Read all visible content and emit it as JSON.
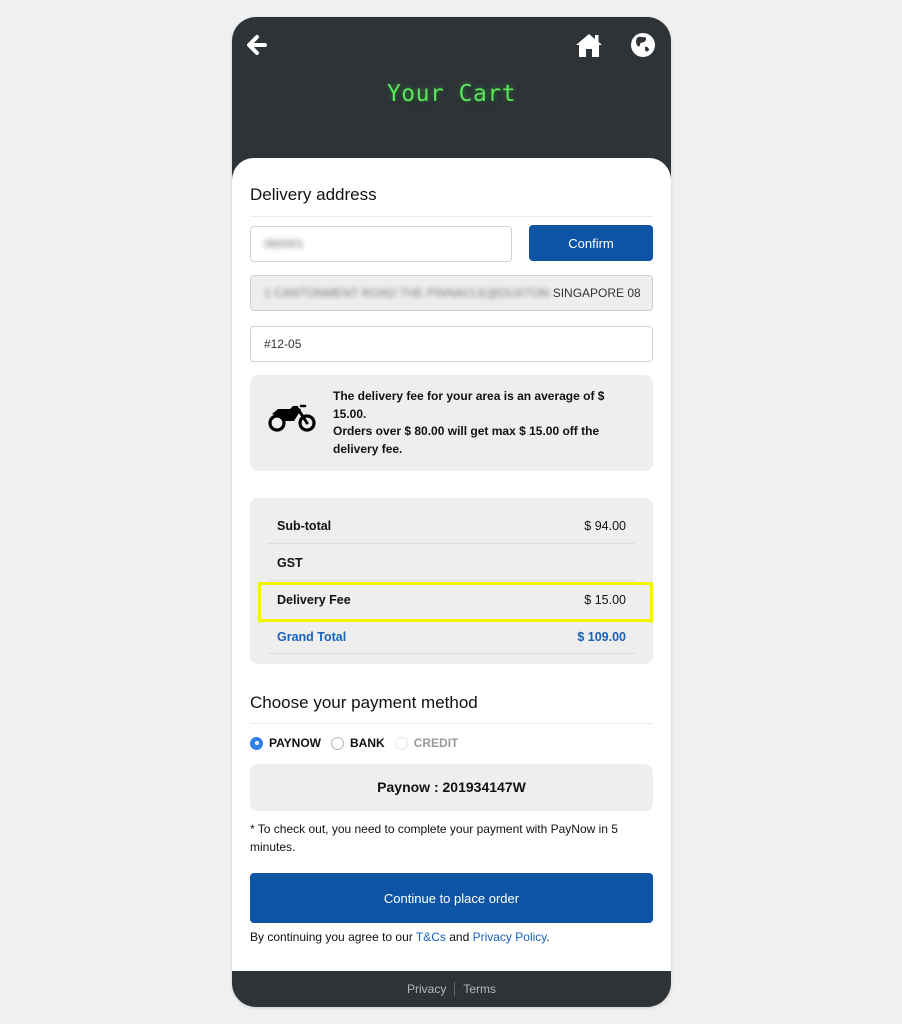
{
  "header": {
    "title": "Your Cart",
    "icons": {
      "back": "arrow-left-icon",
      "home": "home-icon",
      "language": "globe-icon"
    }
  },
  "delivery": {
    "section_title": "Delivery address",
    "postal_code_value": "080001",
    "confirm_label": "Confirm",
    "address_blurred": "1 CANTONMENT ROAD THE PINNACLE@DUXTON",
    "address_visible": "SINGAPORE 08",
    "unit_value": "#12-05",
    "info_icon": "motorcycle-icon",
    "info_line1": "The delivery fee for your area is an average of $ 15.00.",
    "info_line2": "Orders over $ 80.00 will get max $ 15.00 off the delivery fee."
  },
  "totals": {
    "rows": [
      {
        "label": "Sub-total",
        "value": "$ 94.00"
      },
      {
        "label": "GST",
        "value": ""
      },
      {
        "label": "Delivery Fee",
        "value": "$ 15.00"
      },
      {
        "label": "Grand Total",
        "value": "$ 109.00"
      }
    ],
    "grand_color": "#1a62b8",
    "highlight_color": "#f4f400"
  },
  "payment": {
    "section_title": "Choose your payment method",
    "options": [
      {
        "label": "PAYNOW",
        "selected": true,
        "disabled": false
      },
      {
        "label": "BANK",
        "selected": false,
        "disabled": false
      },
      {
        "label": "CREDIT",
        "selected": false,
        "disabled": true
      }
    ],
    "paynow_text": "Paynow : 201934147W",
    "note": "* To check out, you need to complete your payment with PayNow in 5 minutes.",
    "continue_label": "Continue to place order",
    "agree_prefix": "By continuing you agree to our ",
    "tnc_link": "T&Cs",
    "agree_and": " and ",
    "privacy_policy_link": "Privacy Policy",
    "agree_suffix": ".",
    "accent_color": "#0e54a5"
  },
  "footer": {
    "privacy": "Privacy",
    "terms": "Terms"
  }
}
